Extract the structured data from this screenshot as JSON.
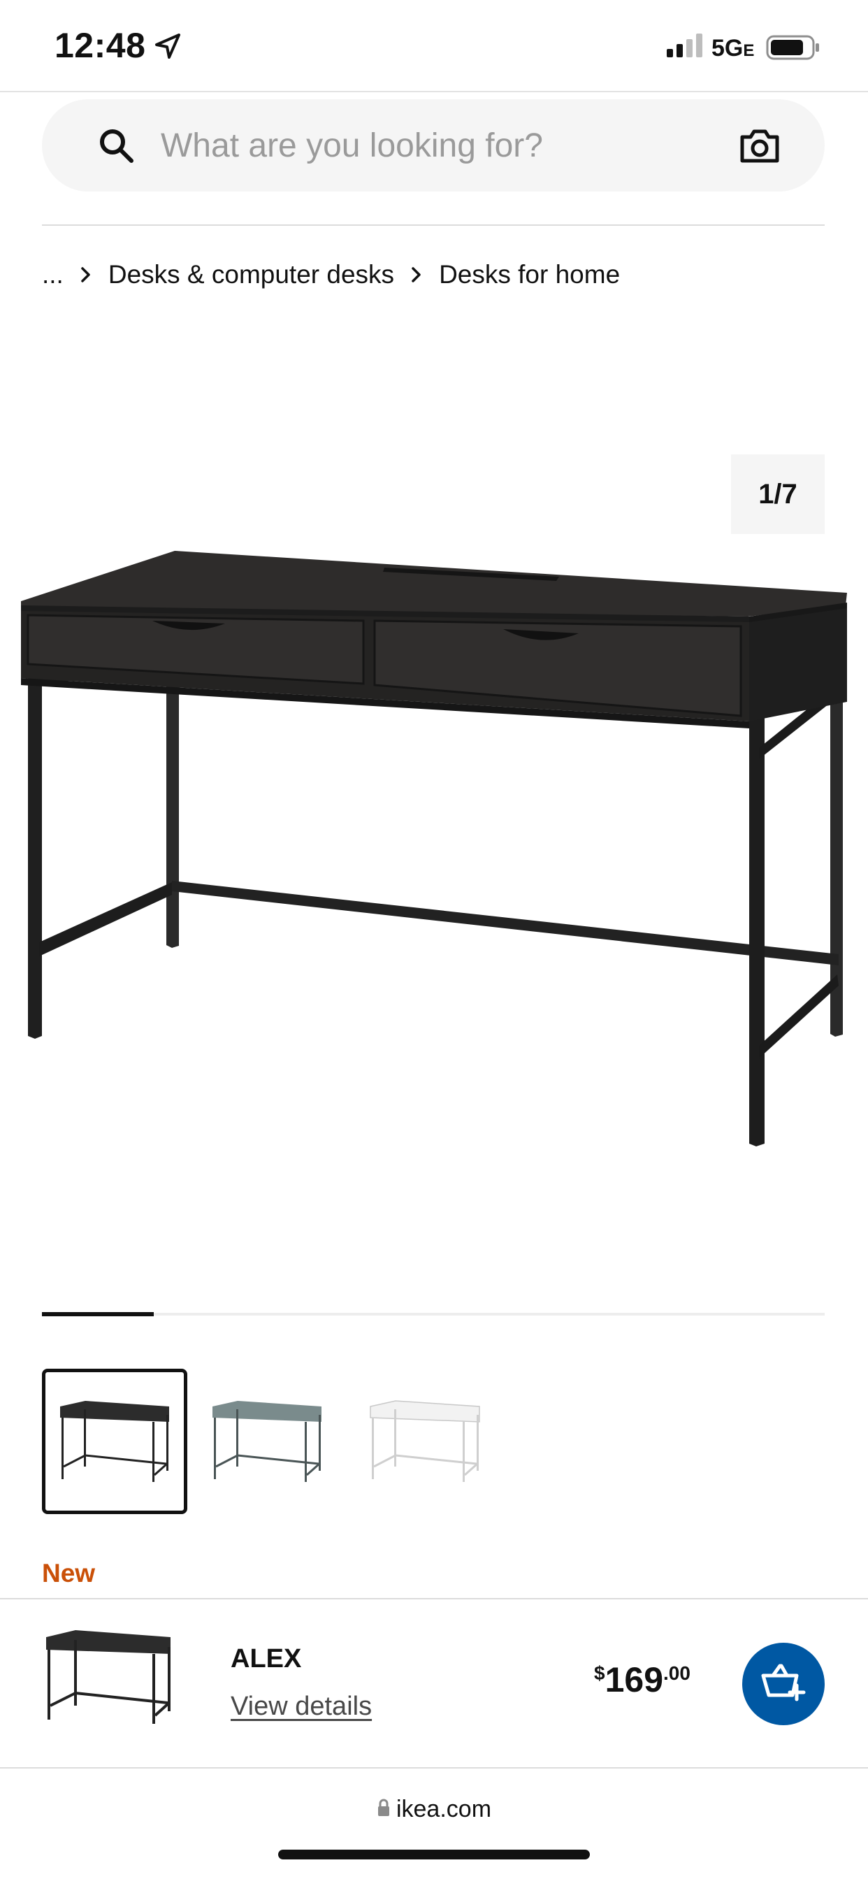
{
  "status_bar": {
    "time": "12:48",
    "network": "5G",
    "network_suffix": "E"
  },
  "search": {
    "placeholder": "What are you looking for?",
    "value": ""
  },
  "breadcrumb": {
    "items": [
      "...",
      "Desks & computer desks",
      "Desks for home"
    ]
  },
  "gallery": {
    "counter": "1/7",
    "progress": 0.143
  },
  "thumbnails": {
    "variants": [
      "black-brown",
      "grey-turquoise",
      "white"
    ],
    "selected": 0
  },
  "product": {
    "badge": "New",
    "name": "ALEX",
    "view_details": "View details",
    "price_currency": "$",
    "price_int": "169",
    "price_dec": ".00"
  },
  "browser": {
    "url": "ikea.com"
  },
  "colors": {
    "new_badge": "#ca5008",
    "cart_button": "#0058a3"
  }
}
